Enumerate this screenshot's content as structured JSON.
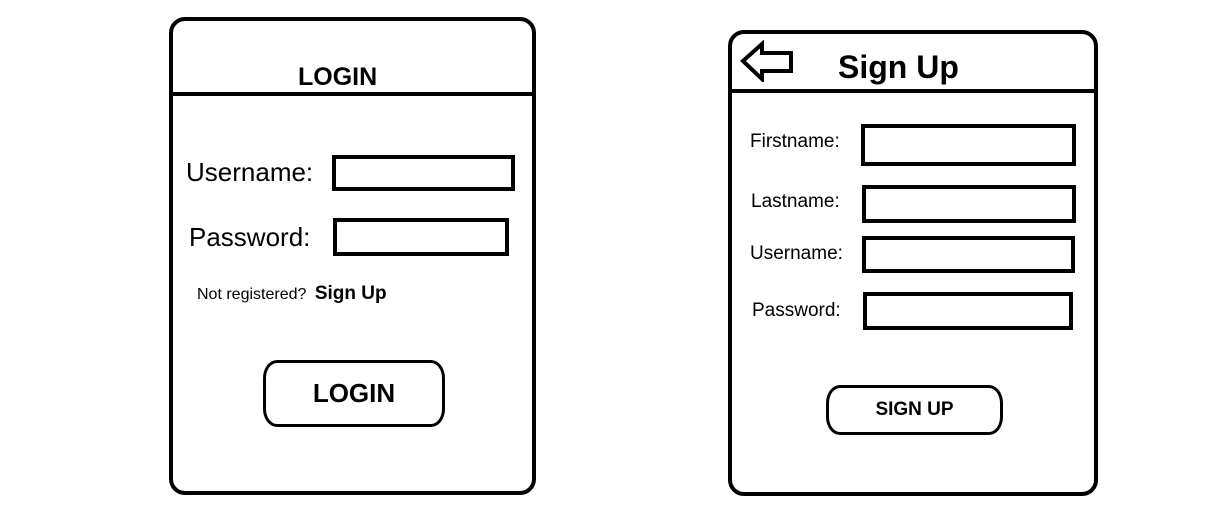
{
  "login": {
    "title": "LOGIN",
    "username_label": "Username:",
    "password_label": "Password:",
    "not_registered_text": "Not registered?",
    "signup_link": "Sign Up",
    "login_button": "LOGIN"
  },
  "signup": {
    "back_icon": "back-arrow-icon",
    "title": "Sign Up",
    "firstname_label": "Firstname:",
    "lastname_label": "Lastname:",
    "username_label": "Username:",
    "password_label": "Password:",
    "signup_button": "SIGN UP"
  }
}
